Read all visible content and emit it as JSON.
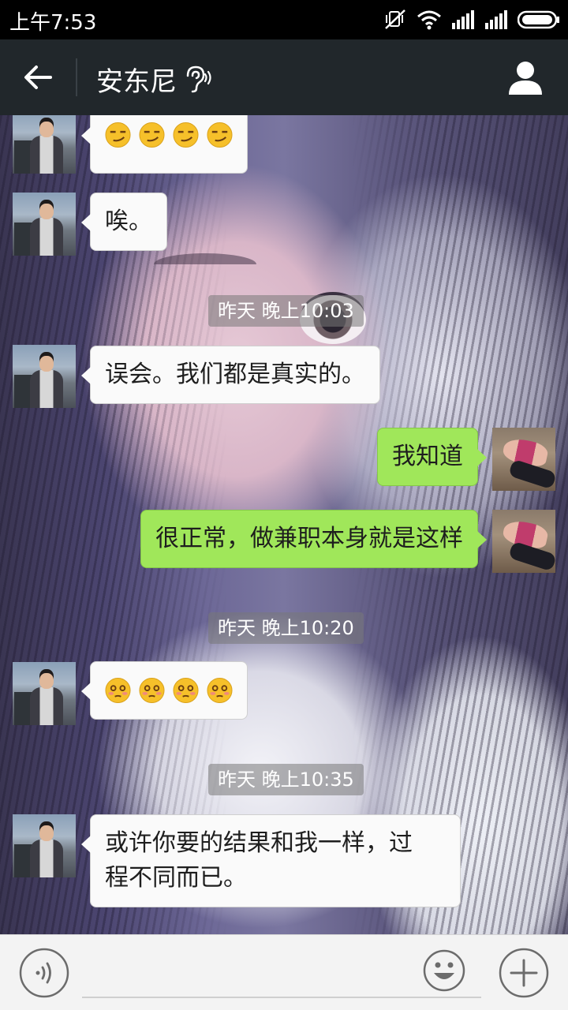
{
  "status_bar": {
    "time": "上午7:53",
    "icons": [
      "mute-icon",
      "wifi-icon",
      "signal-icon",
      "signal-icon",
      "battery-icon"
    ]
  },
  "header": {
    "title": "安东尼",
    "back_icon": "arrow-left-icon",
    "ear_icon": "ear-icon",
    "contact_icon": "person-icon"
  },
  "messages": [
    {
      "side": "left",
      "type": "emoji",
      "emoji": "smirk",
      "count": 4
    },
    {
      "side": "left",
      "type": "text",
      "text": "唉。"
    },
    {
      "type": "time",
      "text": "昨天 晚上10:03"
    },
    {
      "side": "left",
      "type": "text",
      "text": "误会。我们都是真实的。"
    },
    {
      "side": "right",
      "type": "text",
      "text": "我知道"
    },
    {
      "side": "right",
      "type": "text",
      "text": "很正常，做兼职本身就是这样"
    },
    {
      "type": "time",
      "text": "昨天 晚上10:20"
    },
    {
      "side": "left",
      "type": "emoji",
      "emoji": "blush",
      "count": 4
    },
    {
      "type": "time",
      "text": "昨天 晚上10:35"
    },
    {
      "side": "left",
      "type": "text",
      "text_line1": "或许你要的结果和我一样，过",
      "text_line2": "程不同而已。"
    }
  ],
  "input_bar": {
    "voice_icon": "voice-icon",
    "emoji_icon": "smiley-icon",
    "plus_icon": "plus-icon",
    "placeholder": ""
  },
  "colors": {
    "header_bg": "#21272b",
    "sent_bubble": "#a0e75a",
    "received_bubble": "#fafafa"
  }
}
